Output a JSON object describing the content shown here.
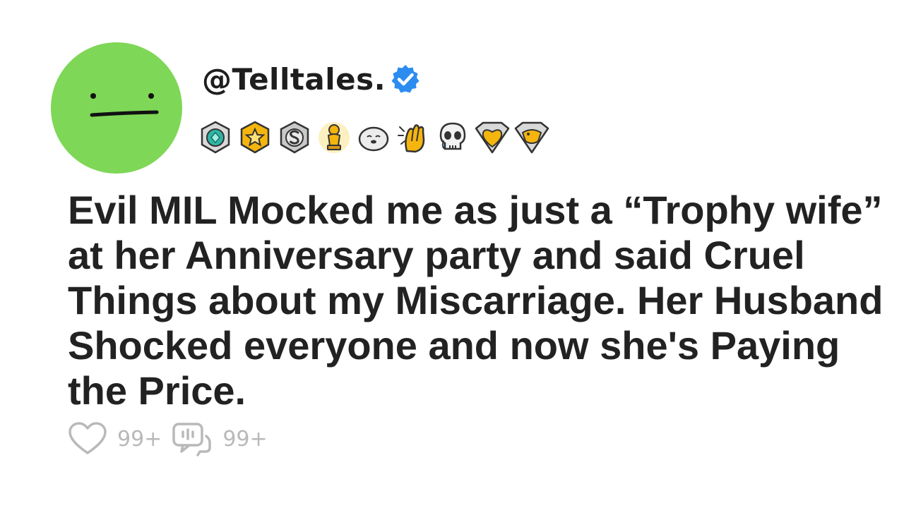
{
  "post": {
    "username": "@Telltales.",
    "title": "Evil MIL Mocked me as just a “Trophy wife” at her Anniversary party and said Cruel Things about my Miscarriage. Her Husband Shocked everyone and now she's Paying the Price.",
    "likes_count": "99+",
    "comments_count": "99+"
  },
  "avatar": {
    "icon": "neutral-face-icon",
    "color": "#7ed756"
  },
  "verified_badge": {
    "icon": "verified-checkmark-icon",
    "color": "#2d8cf0"
  },
  "awards": [
    {
      "icon": "teal-gem-award-icon"
    },
    {
      "icon": "gold-star-award-icon"
    },
    {
      "icon": "silver-coin-award-icon"
    },
    {
      "icon": "gold-trophy-award-icon"
    },
    {
      "icon": "seal-award-icon"
    },
    {
      "icon": "clapping-hands-award-icon"
    },
    {
      "icon": "crying-skull-award-icon"
    },
    {
      "icon": "gold-heart-shield-award-icon"
    },
    {
      "icon": "platypus-shield-award-icon"
    }
  ],
  "actions": {
    "like_icon": "heart-outline-icon",
    "comment_icon": "comment-bubble-icon",
    "icon_color": "#b9b9b9"
  }
}
